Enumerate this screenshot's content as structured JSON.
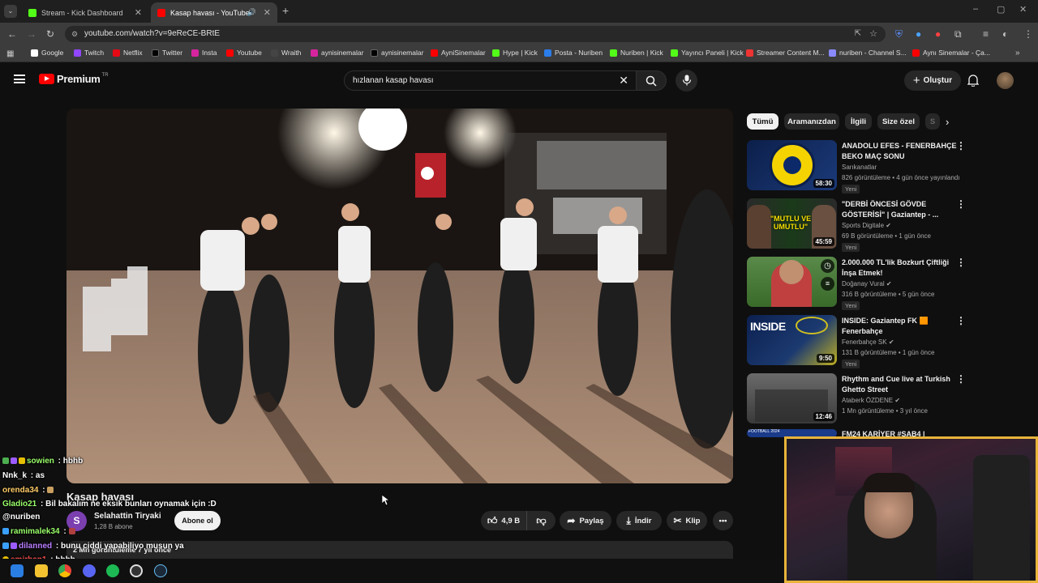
{
  "browser": {
    "tabs": [
      {
        "label": "Stream - Kick Dashboard",
        "active": false
      },
      {
        "label": "Kasap havası - YouTube",
        "active": true
      }
    ],
    "url": "youtube.com/watch?v=9eReCE-BRtE",
    "bookmarks": [
      "Google",
      "Twitch",
      "Netflix",
      "Twitter",
      "Insta",
      "Youtube",
      "Wraith",
      "aynisinemalar",
      "aynisinemalar",
      "AyniSinemalar",
      "Hype | Kick",
      "Posta - Nuriben",
      "Nuriben | Kick",
      "Yayıncı Paneli | Kick",
      "Streamer Content M...",
      "nuriben - Channel S...",
      "Aynı Sinemalar - Ça..."
    ]
  },
  "youtube": {
    "logo": "Premium",
    "logo_region": "TR",
    "search_query": "hızlanan kasap havası",
    "create_label": "Oluştur",
    "chips": [
      "Tümü",
      "Aramanızdan",
      "İlgili",
      "Size özel",
      "S"
    ],
    "video": {
      "title": "Kasap havası",
      "channel": "Selahattin Tiryaki",
      "channel_initial": "S",
      "subscribers": "1,28 B abone",
      "subscribe_label": "Abone ol",
      "likes": "4,9 B",
      "share_label": "Paylaş",
      "download_label": "İndir",
      "clip_label": "Klip",
      "more_label": "•••",
      "views_meta": "2 Mn görüntüleme  7 yıl önce"
    },
    "recommendations": [
      {
        "title": "ANADOLU EFES - FENERBAHÇE BEKO MAÇ SONU",
        "channel": "Sarıkanatlar",
        "meta": "826 görüntüleme • 4 gün önce yayınlandı",
        "badge": "Yeni",
        "duration": "58:30"
      },
      {
        "title": "\"DERBİ ÖNCESİ GÖVDE GÖSTERİSİ\" | Gaziantep - ...",
        "channel": "Sports Digitale",
        "meta": "69 B görüntüleme • 1 gün önce",
        "badge": "Yeni",
        "duration": "45:59",
        "thumb_text": "\"MUTLU VE UMUTLU\""
      },
      {
        "title": "2.000.000 TL'lik Bozkurt Çiftliği İnşa Etmek!",
        "channel": "Doğanay Vural",
        "meta": "316 B görüntüleme • 5 gün önce",
        "badge": "Yeni",
        "duration": ""
      },
      {
        "title": "INSIDE: Gaziantep FK 🟧 Fenerbahçe",
        "channel": "Fenerbahçe SK",
        "meta": "131 B görüntüleme • 1 gün önce",
        "badge": "Yeni",
        "duration": "9:50",
        "thumb_text": "INSIDE"
      },
      {
        "title": "Rhythm and Cue live at Turkish Ghetto Street",
        "channel": "Ataberk ÖZDENE",
        "meta": "1 Mn görüntüleme • 3 yıl önce",
        "badge": "",
        "duration": "12:46"
      },
      {
        "title": "FM24 KARİYER #SAB4 |",
        "channel": "",
        "meta": "",
        "badge": "",
        "duration": "",
        "thumb_text": "FOOTBALL 2024"
      }
    ]
  },
  "chat": [
    {
      "user": "sowien",
      "msg": " : hbhb",
      "color": "#9aff6a"
    },
    {
      "user": "Nnk_k",
      "msg": " : as",
      "color": "#ffffff"
    },
    {
      "user": "orenda34",
      "msg": " : ",
      "color": "#ffcc66"
    },
    {
      "user": "Gladio21",
      "msg": " : Bil bakalım ne eksik bunları oynamak için :D",
      "color": "#9aff6a"
    },
    {
      "user": "@nuriben",
      "msg": "",
      "color": "#ffffff"
    },
    {
      "user": "ramimalek34",
      "msg": " : ",
      "color": "#9aff6a"
    },
    {
      "user": "dilanned",
      "msg": " : bunu ciddi yapabiliyo musun ya",
      "color": "#b97dff"
    },
    {
      "user": "emirban1",
      "msg": " : hbbb",
      "color": "#ff5050"
    }
  ]
}
